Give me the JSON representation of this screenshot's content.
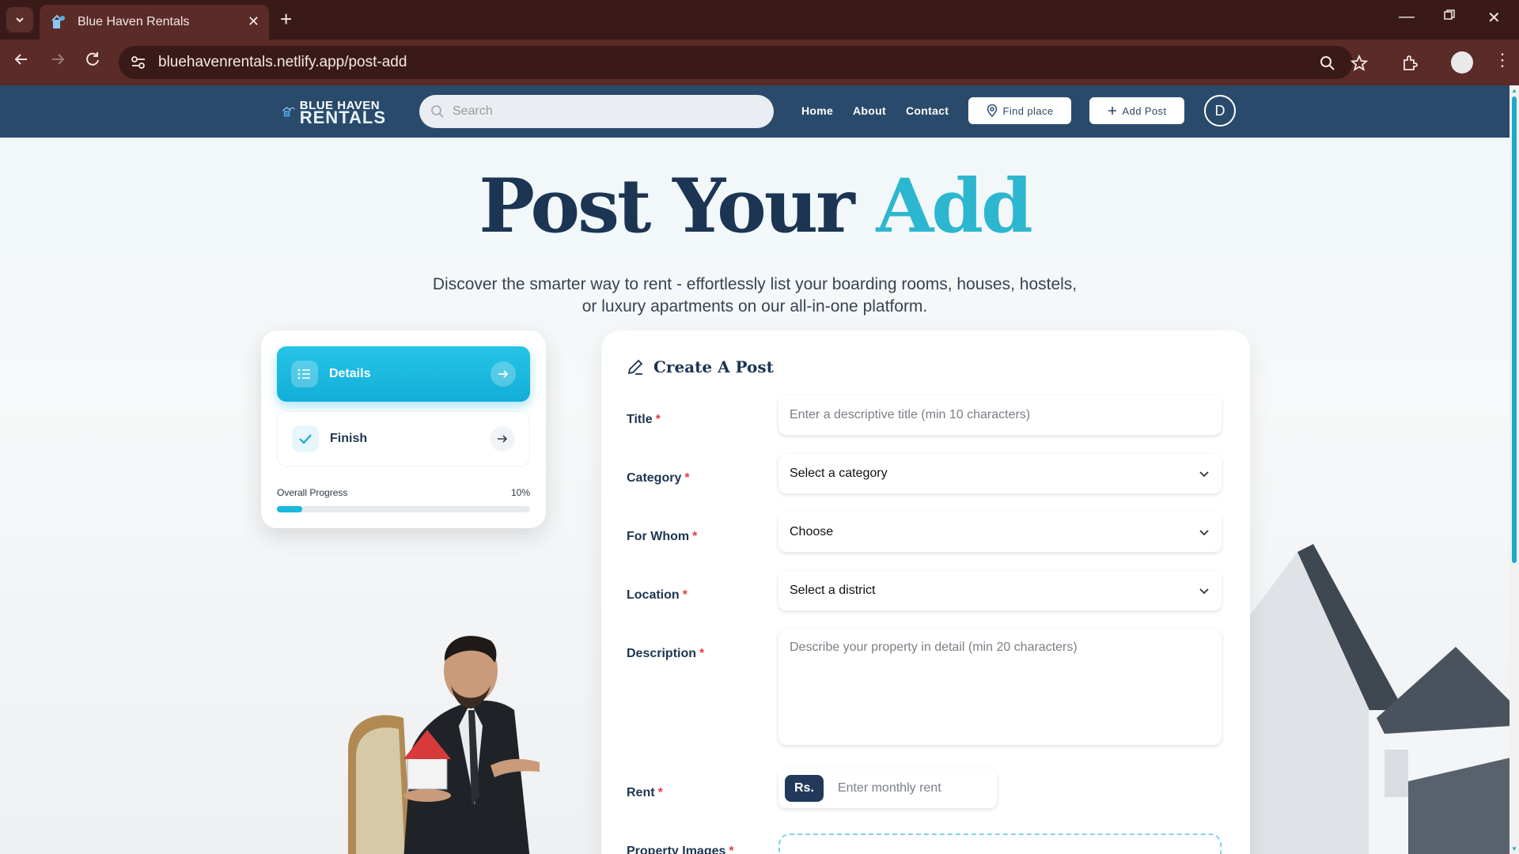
{
  "browser": {
    "tab_title": "Blue Haven Rentals",
    "url": "bluehavenrentals.netlify.app/post-add"
  },
  "site": {
    "logo_line1": "BLUE HAVEN",
    "logo_line2": "RENTALS",
    "search_placeholder": "Search",
    "nav": {
      "home": "Home",
      "about": "About",
      "contact": "Contact",
      "find_place": "Find place",
      "add_post": "Add Post",
      "avatar_initial": "D"
    }
  },
  "hero": {
    "title_main": "Post Your",
    "title_accent": "Add",
    "subtitle_line1": "Discover the smarter way to rent - effortlessly list your boarding rooms, houses, hostels,",
    "subtitle_line2": "or luxury apartments on our all-in-one platform."
  },
  "steps": {
    "items": [
      {
        "label": "Details",
        "state": "active"
      },
      {
        "label": "Finish",
        "state": "inactive"
      }
    ],
    "progress_label": "Overall Progress",
    "progress_text": "10%",
    "progress_value": 0.1
  },
  "form": {
    "heading": "Create A Post",
    "title_label": "Title",
    "title_placeholder": "Enter a descriptive title (min 10 characters)",
    "category_label": "Category",
    "category_value": "Select a category",
    "for_whom_label": "For Whom",
    "for_whom_value": "Choose",
    "location_label": "Location",
    "location_value": "Select a district",
    "description_label": "Description",
    "description_placeholder": "Describe your property in detail (min 20 characters)",
    "rent_label": "Rent",
    "rent_prefix": "Rs.",
    "rent_placeholder": "Enter monthly rent",
    "images_label": "Property Images",
    "required_mark": "*"
  },
  "colors": {
    "navbar": "#2a4a6b",
    "accent": "#2db6cf",
    "heading": "#1c3553",
    "required": "#e53e3e"
  }
}
